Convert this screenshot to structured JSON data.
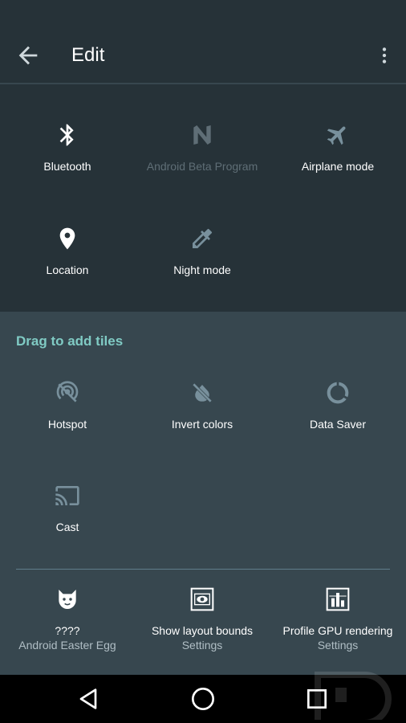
{
  "toolbar": {
    "title": "Edit",
    "back_icon": "arrow-back-icon",
    "more_icon": "more-vert-icon"
  },
  "active_tiles": [
    {
      "label": "Bluetooth",
      "icon": "bluetooth-icon"
    },
    {
      "label": "Android Beta Program",
      "icon": "android-beta-icon",
      "disabled": true
    },
    {
      "label": "Airplane mode",
      "icon": "airplane-icon"
    },
    {
      "label": "Location",
      "icon": "location-pin-icon"
    },
    {
      "label": "Night mode",
      "icon": "eyedropper-icon"
    }
  ],
  "drag_section": {
    "title": "Drag to add tiles",
    "tiles": [
      {
        "label": "Hotspot",
        "icon": "hotspot-icon"
      },
      {
        "label": "Invert colors",
        "icon": "invert-colors-icon"
      },
      {
        "label": "Data Saver",
        "icon": "data-saver-icon"
      },
      {
        "label": "Cast",
        "icon": "cast-icon"
      }
    ],
    "third_party_tiles": [
      {
        "label": "????",
        "sub": "Android Easter Egg",
        "icon": "cat-icon"
      },
      {
        "label": "Show layout bounds",
        "sub": "Settings",
        "icon": "layout-bounds-icon"
      },
      {
        "label": "Profile GPU rendering",
        "sub": "Settings",
        "icon": "gpu-profile-icon"
      }
    ]
  },
  "navbar": {
    "back": "nav-back-icon",
    "home": "nav-home-icon",
    "recents": "nav-recents-icon"
  },
  "colors": {
    "background": "#263238",
    "panel": "#37474f",
    "accent": "#80cbc4",
    "secondary_text": "#b0bec5"
  }
}
